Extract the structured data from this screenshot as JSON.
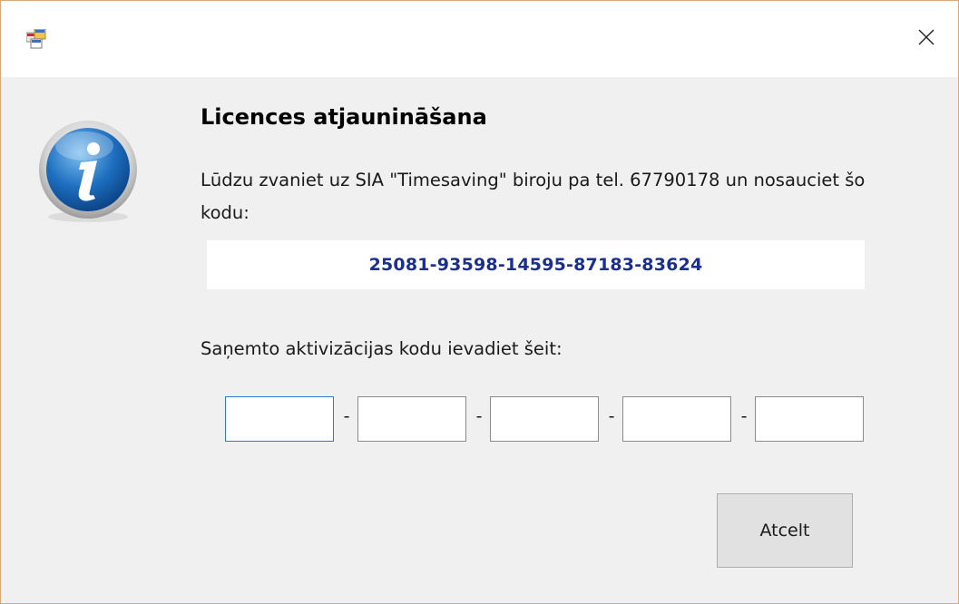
{
  "window": {
    "close_glyph": "×"
  },
  "dialog": {
    "heading": "Licences atjaunināšana",
    "instructions": "Lūdzu zvaniet uz SIA \"Timesaving\" biroju pa tel. 67790178 un nosauciet šo kodu:",
    "request_code": "25081-93598-14595-87183-83624",
    "activation_label": "Saņemto aktivizācijas kodu ievadiet šeit:",
    "activation_fields": [
      "",
      "",
      "",
      "",
      ""
    ],
    "separator": "-",
    "cancel_label": "Atcelt"
  },
  "icons": {
    "app": "app-window-icon",
    "info": "info-icon",
    "close": "close-icon"
  },
  "colors": {
    "code_text": "#1c2f8a",
    "focus_border": "#2a7bd4",
    "dialog_bg": "#f0f0f0",
    "button_bg": "#e1e1e1"
  }
}
